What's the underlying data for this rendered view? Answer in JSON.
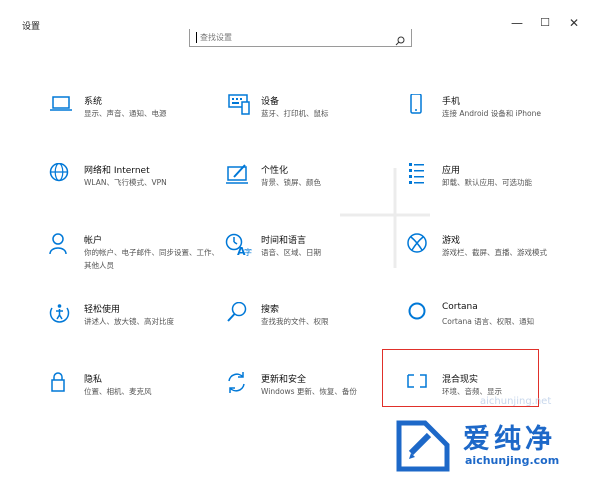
{
  "window": {
    "title": "设置",
    "minimize": "—",
    "maximize": "☐",
    "close": "✕"
  },
  "search": {
    "placeholder": "查找设置"
  },
  "tiles": [
    {
      "name": "系统",
      "desc": "显示、声音、通知、电源",
      "icon": "laptop-icon"
    },
    {
      "name": "设备",
      "desc": "蓝牙、打印机、鼠标",
      "icon": "keyboard-icon"
    },
    {
      "name": "手机",
      "desc": "连接 Android 设备和 iPhone",
      "icon": "phone-icon"
    },
    {
      "name": "网络和 Internet",
      "desc": "WLAN、飞行模式、VPN",
      "icon": "globe-icon"
    },
    {
      "name": "个性化",
      "desc": "背景、锁屏、颜色",
      "icon": "paint-icon"
    },
    {
      "name": "应用",
      "desc": "卸载、默认应用、可选功能",
      "icon": "apps-list-icon"
    },
    {
      "name": "帐户",
      "desc": "你的帐户、电子邮件、同步设置、工作、其他人员",
      "icon": "person-icon"
    },
    {
      "name": "时间和语言",
      "desc": "语音、区域、日期",
      "icon": "time-language-icon"
    },
    {
      "name": "游戏",
      "desc": "游戏栏、截屏、直播、游戏模式",
      "icon": "xbox-icon"
    },
    {
      "name": "轻松使用",
      "desc": "讲述人、放大镜、高对比度",
      "icon": "ease-of-access-icon"
    },
    {
      "name": "搜索",
      "desc": "查找我的文件、权限",
      "icon": "search-icon"
    },
    {
      "name": "Cortana",
      "desc": "Cortana 语言、权限、通知",
      "icon": "cortana-icon"
    },
    {
      "name": "隐私",
      "desc": "位置、相机、麦克风",
      "icon": "lock-icon"
    },
    {
      "name": "更新和安全",
      "desc": "Windows 更新、恢复、备份",
      "icon": "sync-icon"
    },
    {
      "name": "混合现实",
      "desc": "环境、音频、显示",
      "icon": "mixed-reality-icon"
    }
  ],
  "watermark": {
    "name": "爱纯净",
    "url": "aichunjing.com",
    "faint_url": "aichunjing.net"
  },
  "colors": {
    "accent": "#0078d7",
    "highlight": "#e0302a",
    "watermark": "#1d68c8"
  }
}
